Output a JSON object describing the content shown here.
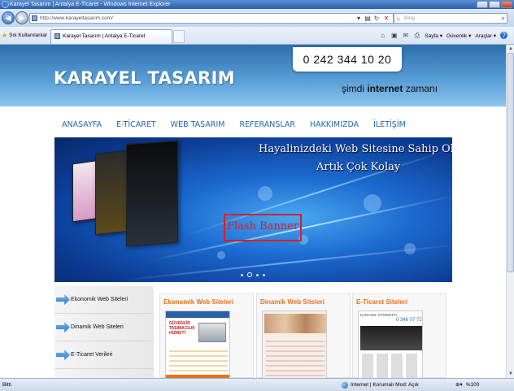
{
  "window": {
    "title": "Karayel Tasarım | Antalya E-Ticaret - Windows Internet Explorer"
  },
  "address": {
    "url": "http://www.karayeltasarim.com/",
    "search_placeholder": "Bing"
  },
  "commandbar": {
    "favorites_label": "Sık Kullanılanlar",
    "tab_title": "Karayel Tasarım | Antalya E-Ticaret",
    "page_menu": "Sayfa ▾",
    "safety_menu": "Güvenlik ▾",
    "tools_menu": "Araçlar ▾",
    "help_icon": "help-icon"
  },
  "site": {
    "logo": "KARAYEL TASARIM",
    "phone": "0 242 344 10 20",
    "slogan_pre": "şimdi ",
    "slogan_bold": "internet",
    "slogan_post": " zamanı",
    "nav": [
      "ANASAYFA",
      "E-TİCARET",
      "WEB TASARIM",
      "REFERANSLAR",
      "HAKKIMIZDA",
      "İLETİŞİM"
    ],
    "banner": {
      "headline1": "Hayalinizdeki Web Sitesine Sahip Olmak",
      "headline2": "Artık Çok Kolay",
      "flash_label": "Flash Banner",
      "slides": 4,
      "active_slide": 2
    },
    "left_menu": [
      "Ekonomik Web Siteleri",
      "Dinamik Web Siteleri",
      "E-Ticaret Verileri"
    ],
    "cards": [
      {
        "title": "Ekonomik Web Siteleri"
      },
      {
        "title": "Dinamik Web Siteleri"
      },
      {
        "title": "E-Ticaret Siteleri"
      }
    ],
    "card_thumb_text": {
      "truck_title": "GÜVENLİR TAŞIMACILIK HİZMETİ",
      "auto_title": "KARAYEL OTOMOTİV",
      "auto_phone": "0 346 07 72"
    }
  },
  "status": {
    "left": "Bitti",
    "zone": "Internet | Korumalı Mod: Açık",
    "zoom": "%100"
  },
  "colors": {
    "nav": "#2067b0",
    "card_title": "#e8731a",
    "flash_red": "#d3202a"
  }
}
